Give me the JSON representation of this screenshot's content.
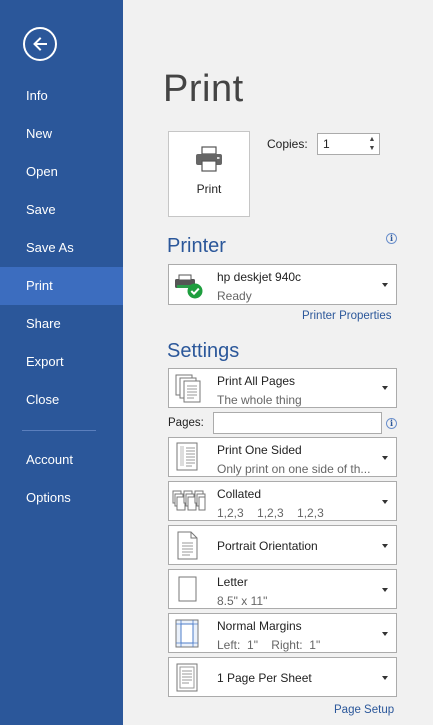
{
  "sidebar": {
    "items": [
      {
        "label": "Info"
      },
      {
        "label": "New"
      },
      {
        "label": "Open"
      },
      {
        "label": "Save"
      },
      {
        "label": "Save As"
      },
      {
        "label": "Print",
        "active": true
      },
      {
        "label": "Share"
      },
      {
        "label": "Export"
      },
      {
        "label": "Close"
      },
      {
        "label": "Account"
      },
      {
        "label": "Options"
      }
    ]
  },
  "main": {
    "title": "Print",
    "print_button_label": "Print",
    "copies_label": "Copies:",
    "copies_value": "1",
    "printer": {
      "section_title": "Printer",
      "name": "hp deskjet 940c",
      "status": "Ready",
      "properties_link": "Printer Properties"
    },
    "settings": {
      "section_title": "Settings",
      "pages_range": {
        "main": "Print All Pages",
        "sub": "The whole thing"
      },
      "pages_label": "Pages:",
      "pages_value": "",
      "sides": {
        "main": "Print One Sided",
        "sub": "Only print on one side of th..."
      },
      "collation": {
        "main": "Collated",
        "sub": "1,2,3    1,2,3    1,2,3"
      },
      "orientation": {
        "main": "Portrait Orientation"
      },
      "paper": {
        "main": "Letter",
        "sub": "8.5\" x 11\""
      },
      "margins": {
        "main": "Normal Margins",
        "sub": "Left:  1\"    Right:  1\""
      },
      "per_sheet": {
        "main": "1 Page Per Sheet"
      },
      "page_setup_link": "Page Setup"
    }
  },
  "colors": {
    "sidebar_bg": "#2b579a",
    "sidebar_active": "#3c6dbf",
    "accent": "#2b579a",
    "status_ok": "#1e9e3e"
  }
}
